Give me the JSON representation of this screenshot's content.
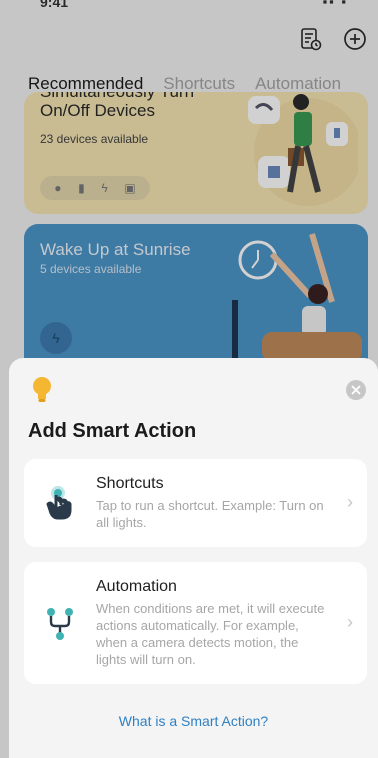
{
  "statusbar": {
    "time": "9:41",
    "indicators": "▪▪ ▪"
  },
  "header": {
    "log_icon": "log-list-icon",
    "add_icon": "plus-circle-icon"
  },
  "tabs": [
    {
      "label": "Recommended",
      "active": true
    },
    {
      "label": "Shortcuts",
      "active": false
    },
    {
      "label": "Automation",
      "active": false
    }
  ],
  "cards": [
    {
      "title_cut": "Simultaneously Turn",
      "title": "On/Off Devices",
      "subtitle": "23 devices available",
      "color": "#f6e6b4"
    },
    {
      "title": "Wake Up at Sunrise",
      "subtitle": "5 devices available",
      "color": "#4b95c9"
    }
  ],
  "sheet": {
    "icon": "lightbulb-icon",
    "title": "Add Smart Action",
    "options": [
      {
        "title": "Shortcuts",
        "description": "Tap to run a shortcut. Example: Turn on all lights.",
        "icon": "tap-hand-icon"
      },
      {
        "title": "Automation",
        "description": "When conditions are met, it will execute actions automatically. For example, when a camera detects motion, the lights will turn on.",
        "icon": "automation-flow-icon"
      }
    ],
    "help_link": "What is a Smart Action?"
  },
  "colors": {
    "accent": "#2f80c2",
    "bulb": "#f5b731",
    "teal": "#3fb3b3"
  }
}
